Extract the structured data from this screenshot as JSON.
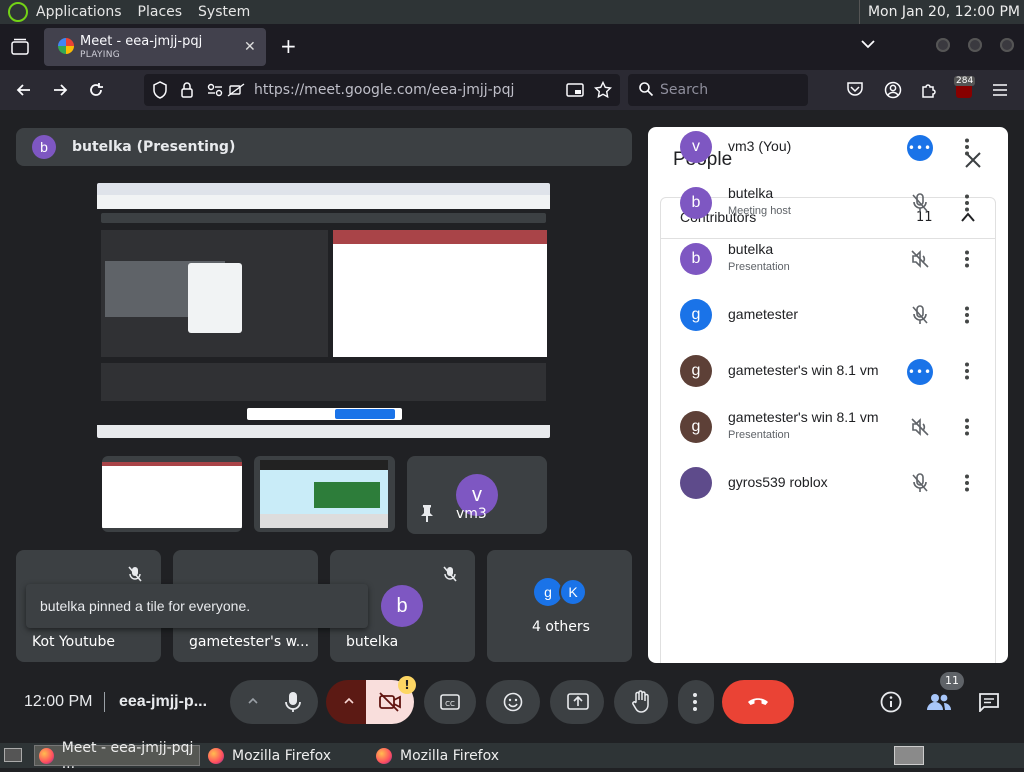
{
  "top_panel": {
    "applications": "Applications",
    "places": "Places",
    "system": "System",
    "clock": "Mon Jan 20, 12:00 PM"
  },
  "browser": {
    "tab_title": "Meet - eea-jmjj-pqj",
    "tab_status": "PLAYING",
    "url": "https://meet.google.com/eea-jmjj-pqj",
    "search_placeholder": "Search",
    "notification_badge": "284"
  },
  "meet": {
    "presenter_avatar": "b",
    "presenter_label": "butelka (Presenting)",
    "tile_vm3_avatar": "v",
    "tile_vm3_label": "vm3",
    "tiles": [
      {
        "label": "Kot Youtube"
      },
      {
        "label": "gametester's w..."
      },
      {
        "label": "butelka",
        "avatar": "b"
      }
    ],
    "others": {
      "avatars": [
        "g",
        "K"
      ],
      "label": "4 others"
    },
    "toast": "butelka pinned a tile for everyone.",
    "time": "12:00 PM",
    "meeting_code": "eea-jmjj-p...",
    "people_count_badge": "11",
    "colors": {
      "bg": "#202124",
      "tile": "#3c4043",
      "end_call": "#ea4335",
      "accent": "#1a73e8"
    }
  },
  "people": {
    "title": "People",
    "section": "Contributors",
    "count": "11",
    "rows": [
      {
        "avatar": "v",
        "name": "vm3 (You)",
        "role": "",
        "color": "#7e57c2"
      },
      {
        "avatar": "b",
        "name": "butelka",
        "role": "Meeting host",
        "color": "#7e57c2"
      },
      {
        "avatar": "b",
        "name": "butelka",
        "role": "Presentation",
        "color": "#7e57c2"
      },
      {
        "avatar": "g",
        "name": "gametester",
        "role": "",
        "color": "#1a73e8"
      },
      {
        "avatar": "g",
        "name": "gametester's win 8.1 vm",
        "role": "",
        "color": "#5d4037"
      },
      {
        "avatar": "g",
        "name": "gametester's win 8.1 vm",
        "role": "Presentation",
        "color": "#5d4037"
      },
      {
        "avatar": "",
        "name": "gyros539 roblox",
        "role": "",
        "color": "#5e4b8b"
      }
    ]
  },
  "taskbar": {
    "items": [
      "Meet - eea-jmjj-pqj ...",
      "Mozilla Firefox",
      "Mozilla Firefox"
    ]
  }
}
